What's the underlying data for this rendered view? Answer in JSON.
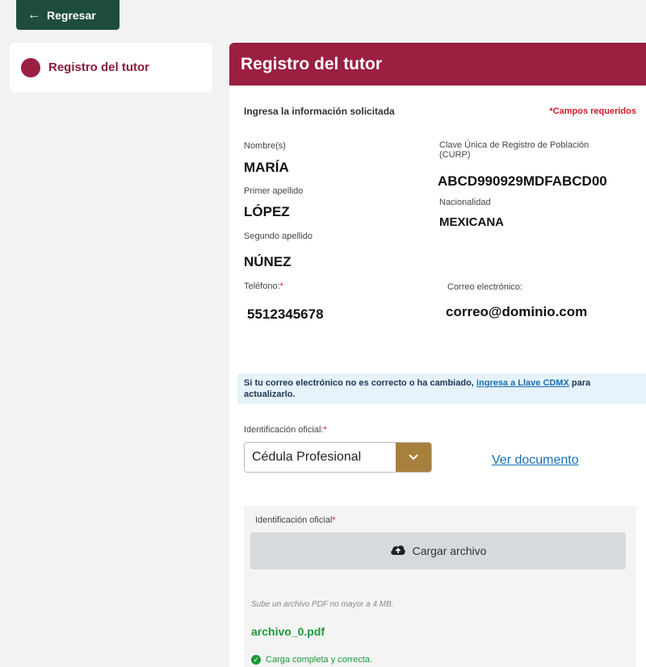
{
  "back_button": {
    "label": "Regresar",
    "icon": "arrow-left-icon"
  },
  "sidebar": {
    "items": [
      {
        "label": "Registro del tutor",
        "active": true
      }
    ]
  },
  "panel": {
    "title": "Registro del tutor",
    "instructions": "Ingresa la información solicitada",
    "required_note": "*Campos requeridos",
    "fields": {
      "nombre": {
        "label": "Nombre(s)",
        "value": "MARÍA"
      },
      "primer_apellido": {
        "label": "Primer apellido",
        "value": "LÓPEZ"
      },
      "segundo_apellido": {
        "label": "Segundo apellido",
        "value": "NÚNEZ"
      },
      "curp": {
        "label": "Clave Única de Registro de Población (CURP)",
        "value": "ABCD990929MDFABCD00"
      },
      "nacionalidad": {
        "label": "Nacionalidad",
        "value": "MEXICANA"
      },
      "telefono": {
        "label": "Teléfono:",
        "value": "5512345678"
      },
      "correo": {
        "label": "Correo electrónico:",
        "value": "correo@dominio.com"
      }
    },
    "info": {
      "prefix": "Si tu correo electrónico no es correcto o ha cambiado,",
      "link": "ingresa a Llave CDMX",
      "suffix": "para actualizarlo."
    },
    "identificacion": {
      "label": "Identificación oficial:",
      "selected": "Cédula Profesional",
      "view_link": "Ver documento"
    },
    "upload": {
      "label": "Identificación oficial",
      "button": "Cargar archivo",
      "hint": "Sube un archivo PDF no mayor a 4 MB.",
      "file_name": "archivo_0.pdf",
      "status": "Carga completa y correcta."
    }
  },
  "colors": {
    "brand": "#9b1f40",
    "back": "#1e4d40",
    "accent": "#a8803e",
    "success": "#1a9a3a",
    "required": "#d2182b"
  }
}
